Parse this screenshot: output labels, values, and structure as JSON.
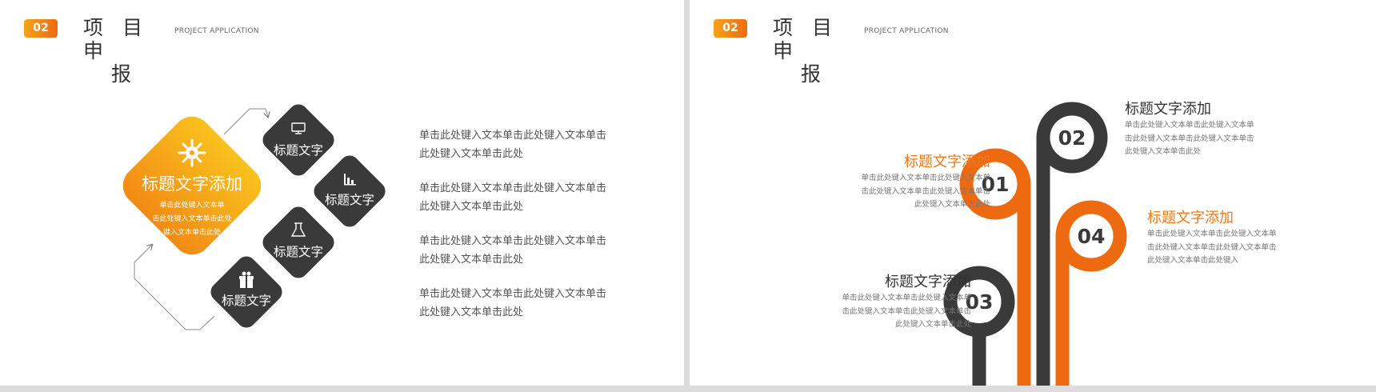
{
  "colors": {
    "accent_orange": "#ee6a10",
    "accent_yellow": "#f7b21b",
    "dark": "#3a3a3a",
    "separator": "#dcdcdc"
  },
  "left": {
    "badge": "02",
    "title_line1": "项 目 申",
    "title_line2": "报",
    "subtitle": "PROJECT APPLICATION",
    "main_diamond": {
      "icon": "virus-gear-icon",
      "title": "标题文字添加",
      "lines": [
        "单击此处键入文本单",
        "击此处键入文本单击此处",
        "键入文本单击此处"
      ]
    },
    "small_diamonds": [
      {
        "icon": "monitor-icon",
        "label": "标题文字"
      },
      {
        "icon": "bar-chart-icon",
        "label": "标题文字"
      },
      {
        "icon": "flask-icon",
        "label": "标题文字"
      },
      {
        "icon": "gift-icon",
        "label": "标题文字"
      }
    ],
    "paragraphs": [
      "单击此处键入文本单击此处键入文本单击此处键入文本单击此处",
      "单击此处键入文本单击此处键入文本单击此处键入文本单击此处",
      "单击此处键入文本单击此处键入文本单击此处键入文本单击此处",
      "单击此处键入文本单击此处键入文本单击此处键入文本单击此处"
    ]
  },
  "right": {
    "badge": "02",
    "title_line1": "项 目 申",
    "title_line2": "报",
    "subtitle": "PROJECT APPLICATION",
    "items": [
      {
        "num": "01",
        "title": "标题文字添加",
        "body": "单击此处键入文本单击此处键入文本单击此处键入文本单击此处键入文本单击此处键入文本单击此处"
      },
      {
        "num": "02",
        "title": "标题文字添加",
        "body": "单击此处键入文本单击此处键入文本单击此处键入文本单击此处键入文本单击此处键入文本单击此处"
      },
      {
        "num": "03",
        "title": "标题文字添加",
        "body": "单击此处键入文本单击此处键入文本单击此处键入文本单击此处键入文本单击此处键入文本单击此处"
      },
      {
        "num": "04",
        "title": "标题文字添加",
        "body": "单击此处键入文本单击此处键入文本单击此处键入文本单击此处键入文本单击此处键入文本单击此处键入"
      }
    ]
  }
}
